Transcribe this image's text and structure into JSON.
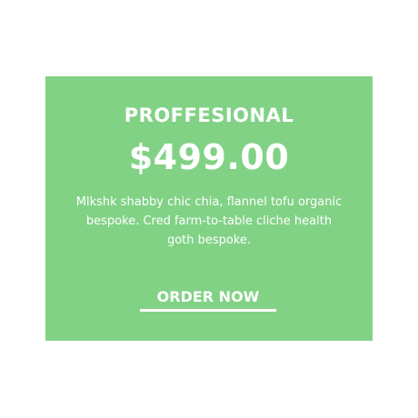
{
  "pricing_card": {
    "plan_name": "PROFFESIONAL",
    "price": "$499.00",
    "description": "Mlkshk shabby chic chia, flannel tofu organic bespoke. Cred farm-to-table cliche health goth bespoke.",
    "cta_label": "ORDER NOW",
    "background_color": "#82d286",
    "text_color": "#ffffff"
  }
}
